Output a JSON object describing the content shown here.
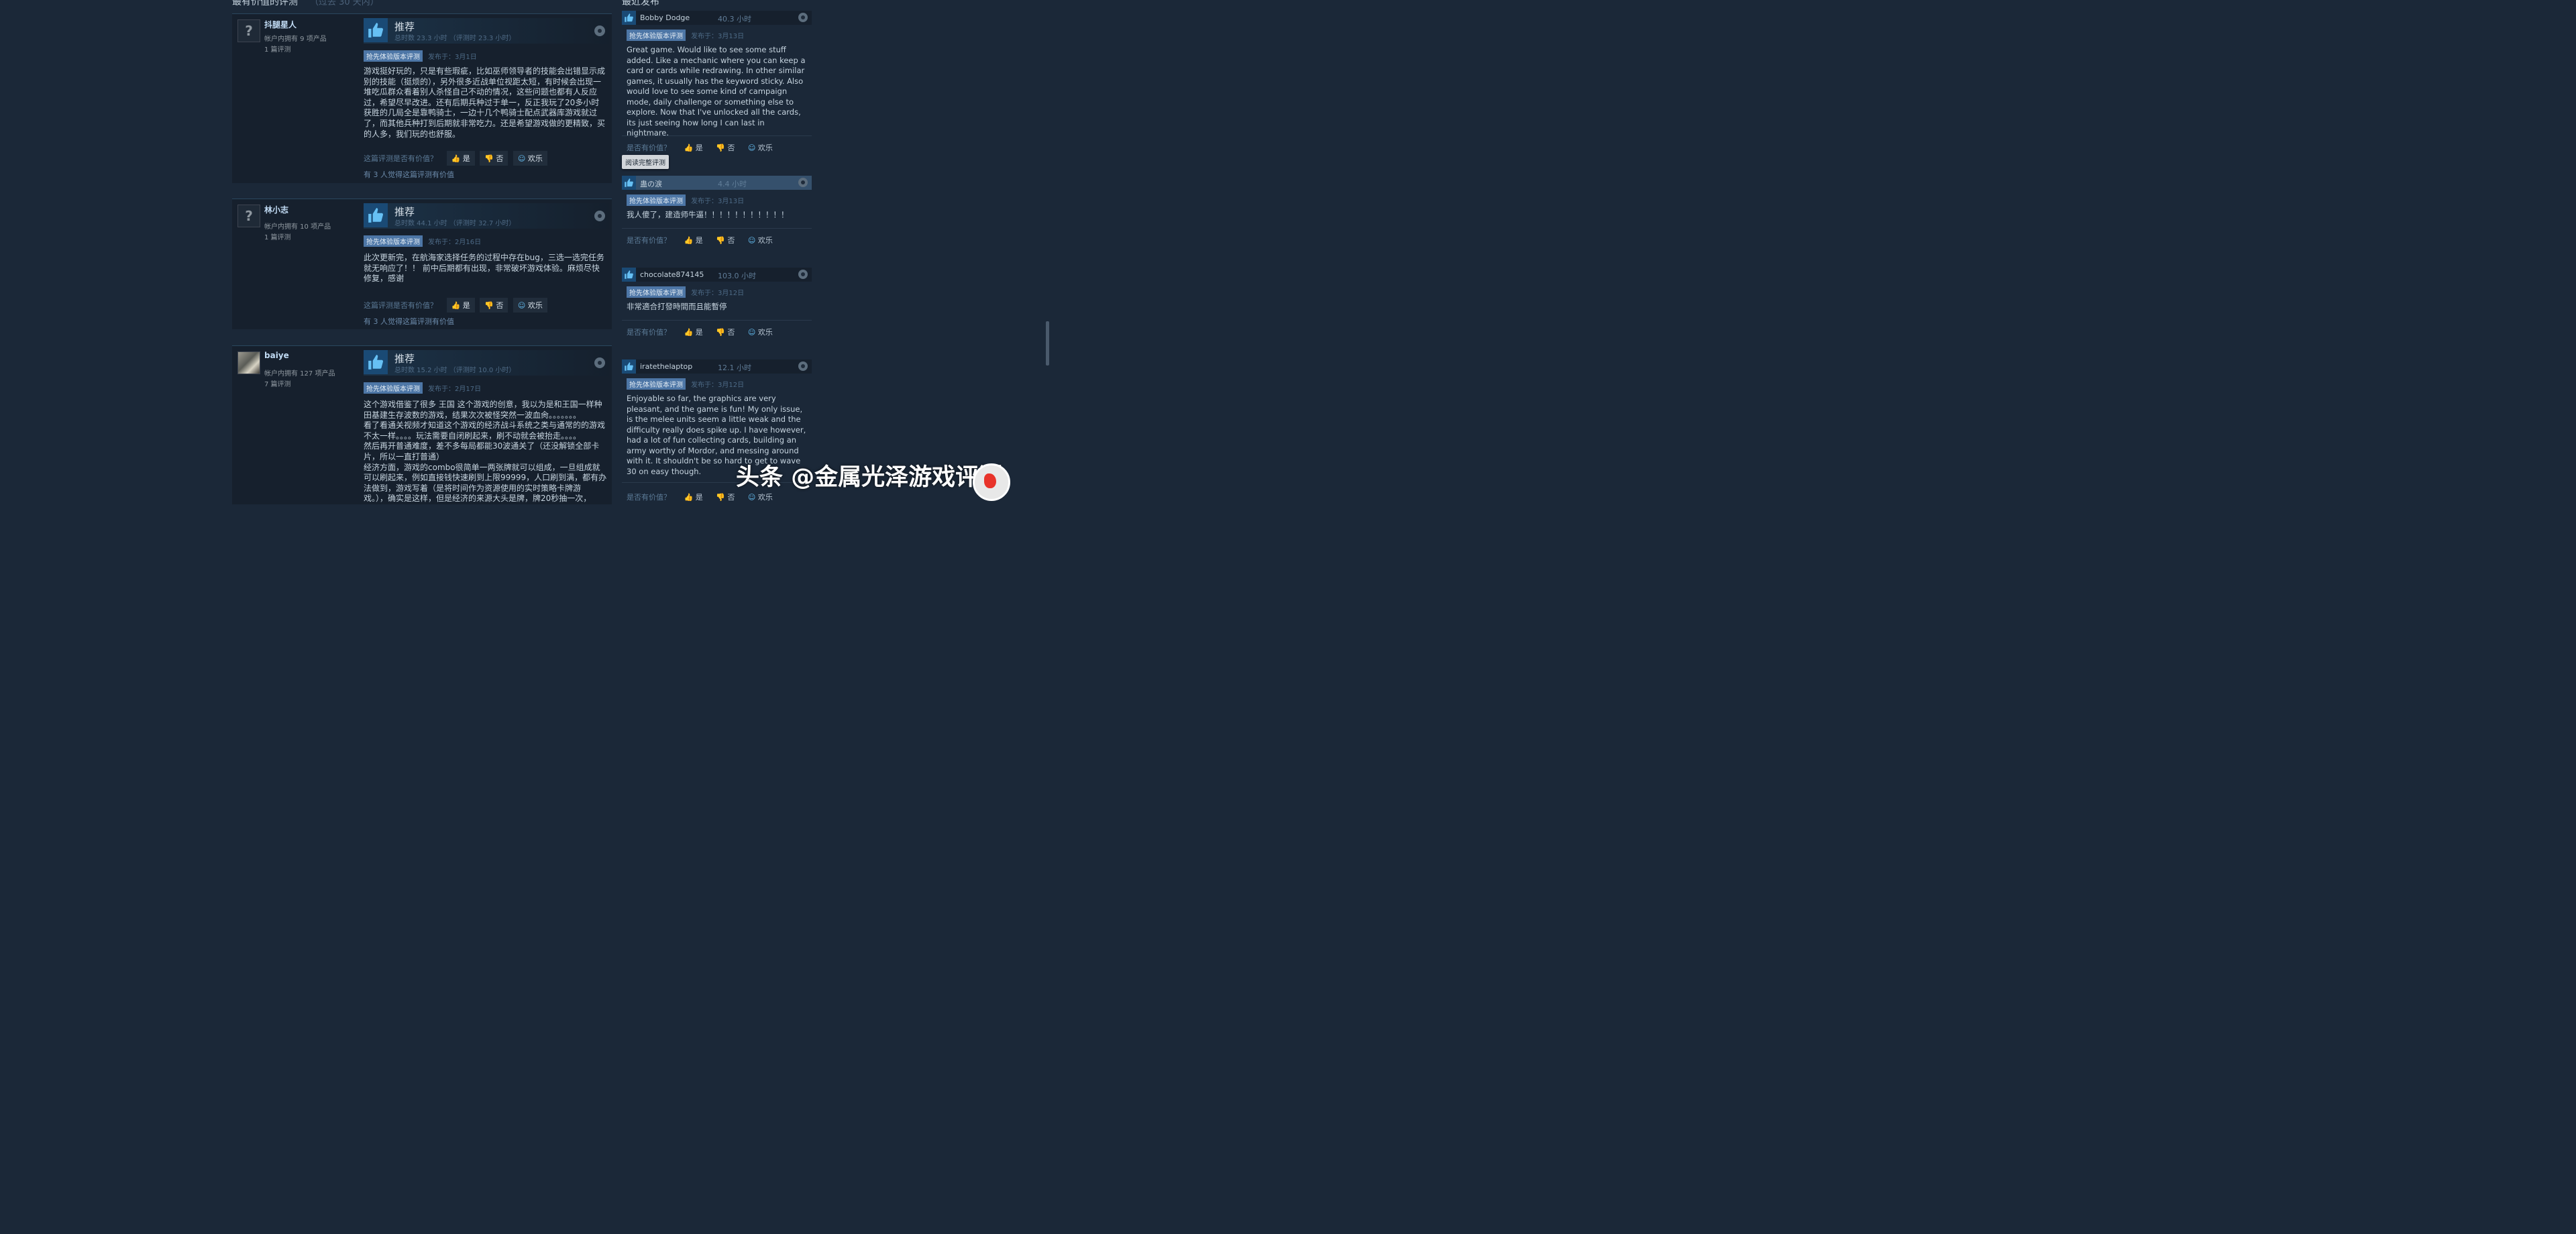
{
  "left_section": {
    "title": "最有价值的评测",
    "subtitle": "（过去 30 天内）"
  },
  "right_section": {
    "title": "最近发布"
  },
  "reviews": [
    {
      "author": "抖腿星人",
      "products": "帐户内拥有 9 项产品",
      "review_count": "1 篇评测",
      "verdict": "推荐",
      "hours": "总时数 23.3 小时   （评测时 23.3 小时）",
      "badge": "抢先体验版本评测",
      "posted": "发布于：3月1日",
      "text": "游戏挺好玩的，只是有些瑕疵，比如巫师领导者的技能会出错显示成别的技能（挺烦的），另外很多近战单位视距太短，有时候会出现一堆吃瓜群众看着别人杀怪自己不动的情况，这些问题也都有人反应过，希望尽早改进。还有后期兵种过于单一，反正我玩了20多小时获胜的几局全是靠鸭骑士，一边十几个鸭骑士配点武器库游戏就过了，而其他兵种打到后期就非常吃力。还是希望游戏做的更精致，买的人多，我们玩的也舒服。",
      "helpful_q": "这篇评测是否有价值？",
      "yes": "是",
      "no": "否",
      "funny": "欢乐",
      "found_helpful": "有 3 人觉得这篇评测有价值"
    },
    {
      "author": "林小志",
      "products": "帐户内拥有 10 项产品",
      "review_count": "1 篇评测",
      "verdict": "推荐",
      "hours": "总时数 44.1 小时   （评测时 32.7 小时）",
      "badge": "抢先体验版本评测",
      "posted": "发布于：2月16日",
      "text": "此次更新完，在航海家选择任务的过程中存在bug，三选一选完任务就无响应了！！ 前中后期都有出现，非常破坏游戏体验。麻烦尽快修复，感谢",
      "helpful_q": "这篇评测是否有价值？",
      "yes": "是",
      "no": "否",
      "funny": "欢乐",
      "found_helpful": "有 3 人觉得这篇评测有价值"
    },
    {
      "author": "baiye",
      "products": "帐户内拥有 127 项产品",
      "review_count": "7 篇评测",
      "verdict": "推荐",
      "hours": "总时数 15.2 小时   （评测时 10.0 小时）",
      "badge": "抢先体验版本评测",
      "posted": "发布于：2月17日",
      "text_lines": [
        "这个游戏借鉴了很多 王国 这个游戏的创意，我以为是和王国一样种",
        "田基建生存波数的游戏，结果次次被怪突然一波血肏。。。。。。。",
        "看了看通关视频才知道这个游戏的经济战斗系统之类与通常的的游戏",
        "不太一样。。。。玩法需要自闭刷起来，刷不动就会被抬走。。。。",
        "然后再开普通难度，差不多每局都能30波通关了（还没解锁全部卡",
        "片，所以一直打普通）",
        "经济方面，游戏的combo很简单一两张牌就可以组成，一旦组成就",
        "可以刷起来，例如直接钱快速刷到上限99999，人口刷到满，都有办",
        "法做到，游戏写着（是将时间作为资源使用的实时策略卡牌游",
        "戏。），确实是这样，但是经济的来源大头是牌，牌20秒抽一次，"
      ]
    }
  ],
  "recent": [
    {
      "author": "Bobby Dodge",
      "hours": "40.3 小时",
      "badge": "抢先体验版本评测",
      "posted": "发布于：3月13日",
      "text": "Great game. Would like to see some stuff added. Like a mechanic where you can keep a card or cards while redrawing. In other similar games, it usually has the keyword sticky. Also would love to see some kind of campaign mode, daily challenge or something else to explore. Now that I've unlocked all the cards, its just seeing how long I can last in nightmare.",
      "helpful_q": "是否有价值？",
      "yes": "是",
      "no": "否",
      "funny": "欢乐"
    },
    {
      "author": "蛊の涙",
      "hours": "4.4 小时",
      "badge": "抢先体验版本评测",
      "posted": "发布于：3月13日",
      "text": "我人傻了，建造师牛逼！！！！！！！！！！！",
      "helpful_q": "是否有价值？",
      "yes": "是",
      "no": "否",
      "funny": "欢乐"
    },
    {
      "author": "chocolate874145",
      "hours": "103.0 小时",
      "badge": "抢先体验版本评测",
      "posted": "发布于：3月12日",
      "text": "非常適合打發時間而且能暫停",
      "helpful_q": "是否有价值？",
      "yes": "是",
      "no": "否",
      "funny": "欢乐"
    },
    {
      "author": "iratethelaptop",
      "hours": "12.1 小时",
      "badge": "抢先体验版本评测",
      "posted": "发布于：3月12日",
      "text": "Enjoyable so far, the graphics are very pleasant, and the game is fun! My only issue, is the melee units seem a little weak and the difficulty really does spike up. I have however, had a lot of fun collecting cards, building an army worthy of Mordor, and messing around with it. It shouldn't be so hard to get to wave 30 on easy though.",
      "helpful_q": "是否有价值？",
      "yes": "是",
      "no": "否",
      "funny": "欢乐"
    }
  ],
  "tooltip": {
    "read_full": "阅读完整评测"
  },
  "watermark": {
    "text": "头条 @金属光泽游戏评测"
  },
  "colors": {
    "background": "#1b2838",
    "panel": "#16202d",
    "badge": "#4d76a6",
    "name": "#c1dbf4"
  }
}
